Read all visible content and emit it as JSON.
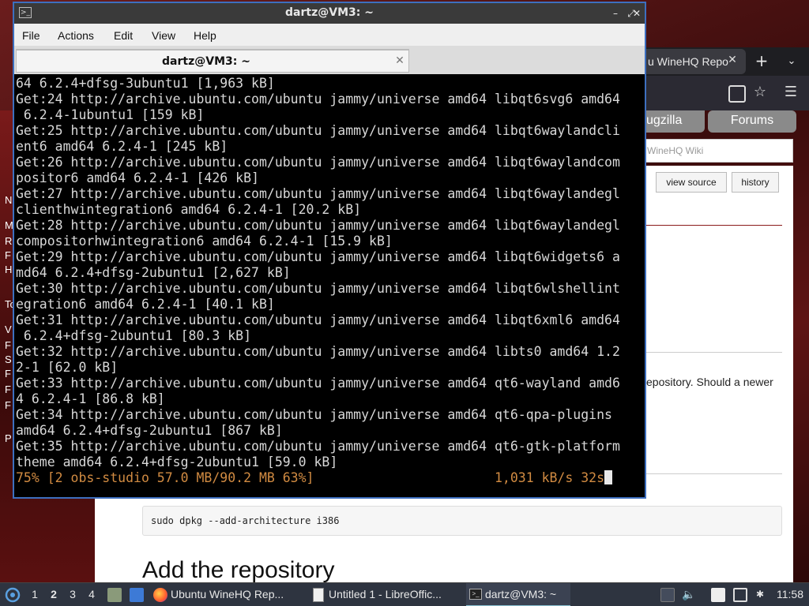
{
  "browser": {
    "tab_title": "u WineHQ Repo",
    "new_tab": "+",
    "tab_list": "⌄",
    "nav_buttons": [
      "ugzilla",
      "Forums"
    ],
    "search_placeholder": "WineHQ Wiki",
    "page_buttons": [
      "view source",
      "history"
    ],
    "para_text": "epository. Should a newer",
    "code": "sudo dpkg --add-architecture i386",
    "heading": "Add the repository",
    "sidebar_letters": [
      "N",
      "M",
      "R",
      "F",
      "H",
      "To",
      "V",
      "F",
      "S",
      "F",
      "F",
      "F",
      "P"
    ]
  },
  "terminal": {
    "window_title": "dartz@VM3: ~",
    "menu": [
      "File",
      "Actions",
      "Edit",
      "View",
      "Help"
    ],
    "tab_label": "dartz@VM3: ~",
    "lines": [
      "64 6.2.4+dfsg-3ubuntu1 [1,963 kB]",
      "Get:24 http://archive.ubuntu.com/ubuntu jammy/universe amd64 libqt6svg6 amd64",
      " 6.2.4-1ubuntu1 [159 kB]",
      "Get:25 http://archive.ubuntu.com/ubuntu jammy/universe amd64 libqt6waylandcli",
      "ent6 amd64 6.2.4-1 [245 kB]",
      "Get:26 http://archive.ubuntu.com/ubuntu jammy/universe amd64 libqt6waylandcom",
      "positor6 amd64 6.2.4-1 [426 kB]",
      "Get:27 http://archive.ubuntu.com/ubuntu jammy/universe amd64 libqt6waylandegl",
      "clienthwintegration6 amd64 6.2.4-1 [20.2 kB]",
      "Get:28 http://archive.ubuntu.com/ubuntu jammy/universe amd64 libqt6waylandegl",
      "compositorhwintegration6 amd64 6.2.4-1 [15.9 kB]",
      "Get:29 http://archive.ubuntu.com/ubuntu jammy/universe amd64 libqt6widgets6 a",
      "md64 6.2.4+dfsg-2ubuntu1 [2,627 kB]",
      "Get:30 http://archive.ubuntu.com/ubuntu jammy/universe amd64 libqt6wlshellint",
      "egration6 amd64 6.2.4-1 [40.1 kB]",
      "Get:31 http://archive.ubuntu.com/ubuntu jammy/universe amd64 libqt6xml6 amd64",
      " 6.2.4+dfsg-2ubuntu1 [80.3 kB]",
      "Get:32 http://archive.ubuntu.com/ubuntu jammy/universe amd64 libts0 amd64 1.2",
      "2-1 [62.0 kB]",
      "Get:33 http://archive.ubuntu.com/ubuntu jammy/universe amd64 qt6-wayland amd6",
      "4 6.2.4-1 [86.8 kB]",
      "Get:34 http://archive.ubuntu.com/ubuntu jammy/universe amd64 qt6-qpa-plugins",
      "amd64 6.2.4+dfsg-2ubuntu1 [867 kB]",
      "Get:35 http://archive.ubuntu.com/ubuntu jammy/universe amd64 qt6-gtk-platform",
      "theme amd64 6.2.4+dfsg-2ubuntu1 [59.0 kB]"
    ],
    "progress_line": "75% [2 obs-studio 57.0 MB/90.2 MB 63%]                       1,031 kB/s 32s"
  },
  "taskbar": {
    "workspaces": [
      "1",
      "2",
      "3",
      "4"
    ],
    "active_workspace": "2",
    "tasks": [
      "Ubuntu WineHQ Rep...",
      "Untitled 1 - LibreOffic...",
      "dartz@VM3: ~"
    ],
    "clock": "11:58"
  },
  "colors": {
    "progress": "#d18b42",
    "terminal_border": "#3d6fbf",
    "taskbar": "#2e3440"
  }
}
